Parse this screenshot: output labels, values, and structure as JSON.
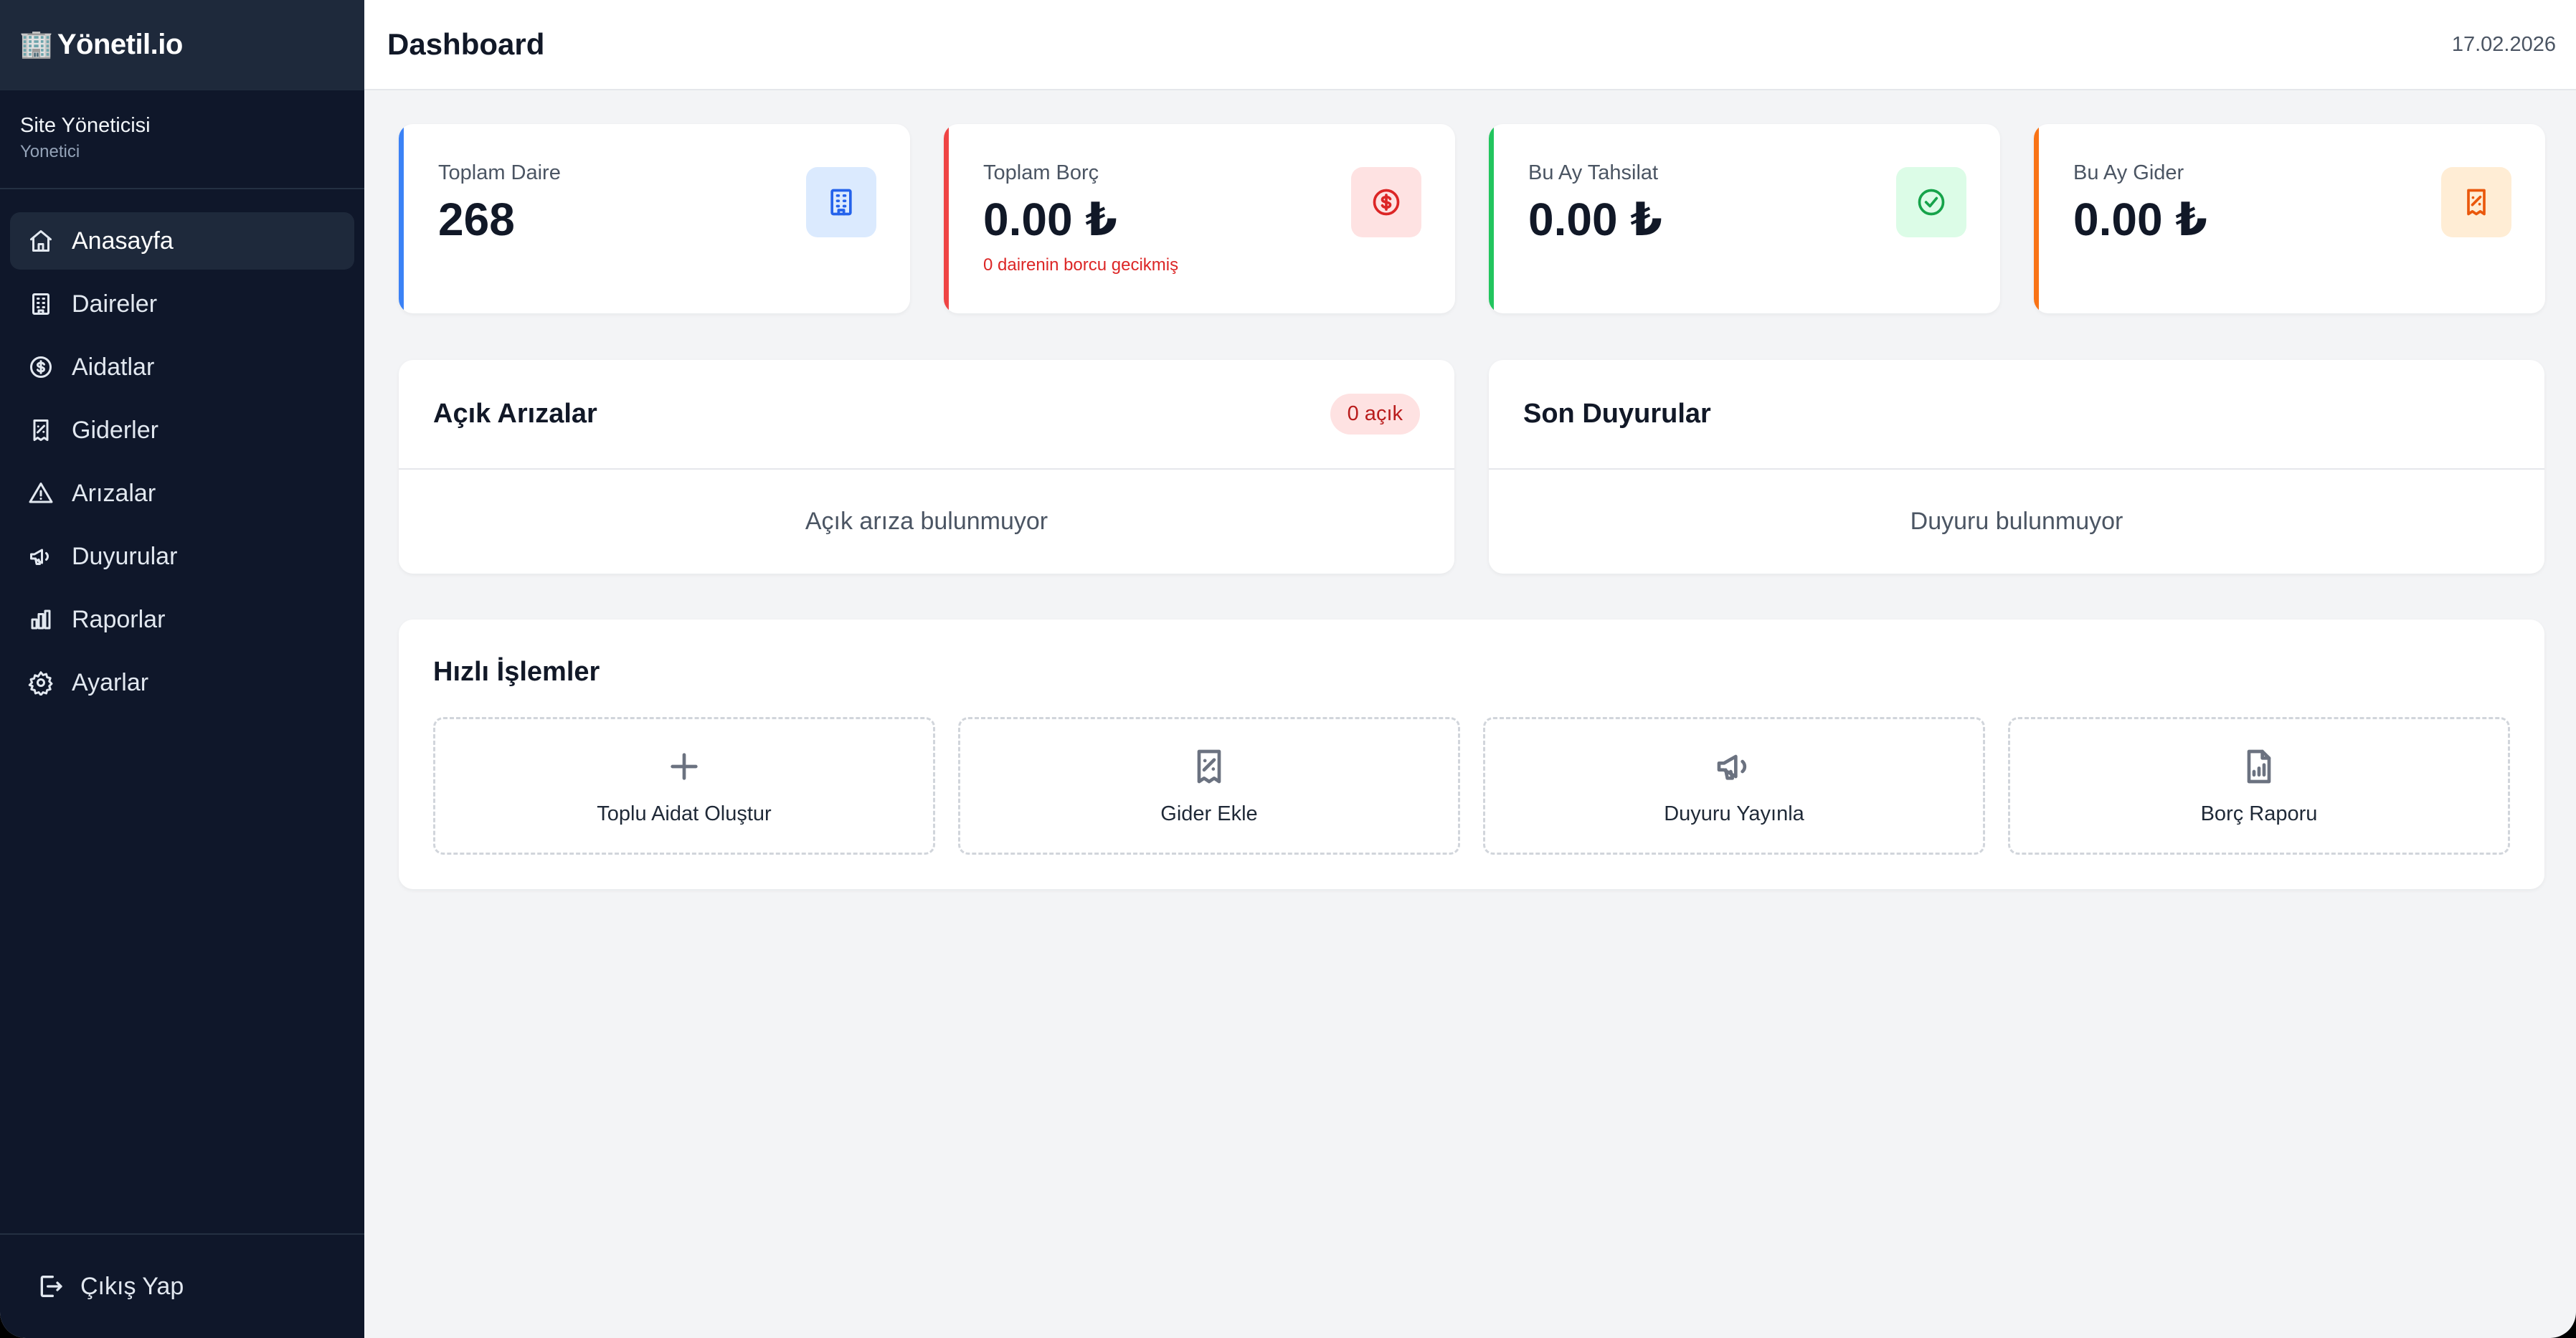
{
  "app": {
    "brand_icon": "🏢",
    "brand_name": "Yönetil.io"
  },
  "user": {
    "name": "Site Yöneticisi",
    "role": "Yonetici"
  },
  "sidebar": {
    "items": [
      {
        "label": "Anasayfa",
        "icon": "home-icon",
        "active": true
      },
      {
        "label": "Daireler",
        "icon": "building-icon"
      },
      {
        "label": "Aidatlar",
        "icon": "dollar-circle-icon"
      },
      {
        "label": "Giderler",
        "icon": "receipt-icon"
      },
      {
        "label": "Arızalar",
        "icon": "warning-triangle-icon"
      },
      {
        "label": "Duyurular",
        "icon": "megaphone-icon"
      },
      {
        "label": "Raporlar",
        "icon": "bar-chart-icon"
      },
      {
        "label": "Ayarlar",
        "icon": "gear-icon"
      }
    ],
    "logout_label": "Çıkış Yap"
  },
  "header": {
    "title": "Dashboard",
    "date": "17.02.2026"
  },
  "stats": [
    {
      "label": "Toplam Daire",
      "value": "268",
      "sub": "",
      "accent": "#3b82f6",
      "icon": "building-icon"
    },
    {
      "label": "Toplam Borç",
      "value": "0.00 ₺",
      "sub": "0 dairenin borcu gecikmiş",
      "accent": "#ef4444",
      "icon": "dollar-circle-icon"
    },
    {
      "label": "Bu Ay Tahsilat",
      "value": "0.00 ₺",
      "sub": "",
      "accent": "#22c55e",
      "icon": "check-circle-icon"
    },
    {
      "label": "Bu Ay Gider",
      "value": "0.00 ₺",
      "sub": "",
      "accent": "#f97316",
      "icon": "receipt-icon"
    }
  ],
  "faults": {
    "title": "Açık Arızalar",
    "badge": "0 açık",
    "empty": "Açık arıza bulunmuyor"
  },
  "announcements": {
    "title": "Son Duyurular",
    "empty": "Duyuru bulunmuyor"
  },
  "quick_actions": {
    "title": "Hızlı İşlemler",
    "items": [
      {
        "label": "Toplu Aidat Oluştur",
        "icon": "plus-icon"
      },
      {
        "label": "Gider Ekle",
        "icon": "receipt-icon"
      },
      {
        "label": "Duyuru Yayınla",
        "icon": "megaphone-icon"
      },
      {
        "label": "Borç Raporu",
        "icon": "file-chart-icon"
      }
    ]
  }
}
